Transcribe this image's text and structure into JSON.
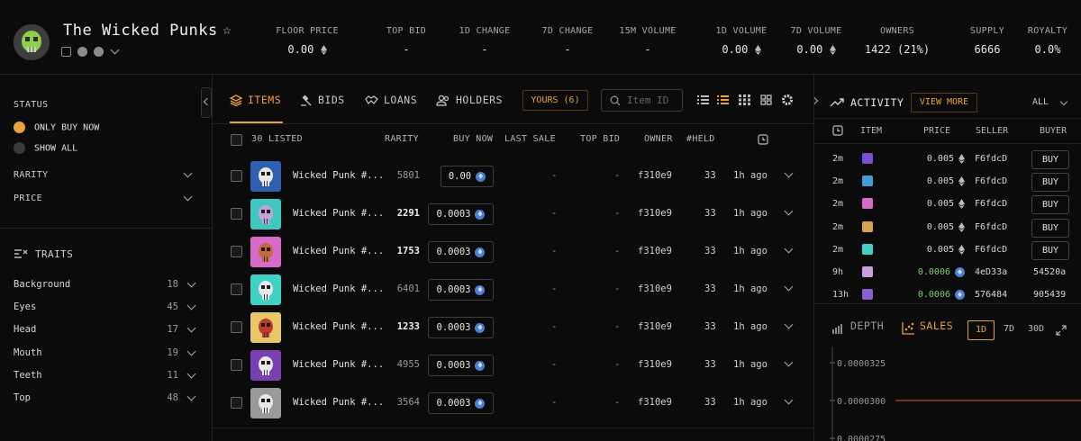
{
  "collection": {
    "title": "The Wicked Punks",
    "stats": [
      {
        "label": "FLOOR PRICE",
        "value": "0.00",
        "eth": true
      },
      {
        "label": "TOP BID",
        "value": "-",
        "eth": false
      },
      {
        "label": "1D CHANGE",
        "value": "-",
        "eth": false
      },
      {
        "label": "7D CHANGE",
        "value": "-",
        "eth": false
      },
      {
        "label": "15M VOLUME",
        "value": "-",
        "eth": false
      },
      {
        "label": "1D VOLUME",
        "value": "0.00",
        "eth": true
      },
      {
        "label": "7D VOLUME",
        "value": "0.00",
        "eth": true
      },
      {
        "label": "OWNERS",
        "value": "1422 (21%)",
        "eth": false
      },
      {
        "label": "SUPPLY",
        "value": "6666",
        "eth": false
      },
      {
        "label": "ROYALTY",
        "value": "0.0%",
        "eth": false
      }
    ]
  },
  "sidebar": {
    "status_label": "STATUS",
    "only_buy_now": "ONLY BUY NOW",
    "show_all": "SHOW ALL",
    "rarity": "RARITY",
    "price": "PRICE",
    "traits_label": "TRAITS",
    "traits": [
      {
        "name": "Background",
        "count": "18"
      },
      {
        "name": "Eyes",
        "count": "45"
      },
      {
        "name": "Head",
        "count": "17"
      },
      {
        "name": "Mouth",
        "count": "19"
      },
      {
        "name": "Teeth",
        "count": "11"
      },
      {
        "name": "Top",
        "count": "48"
      }
    ]
  },
  "main": {
    "tabs": [
      {
        "label": "ITEMS",
        "icon": "layers-icon",
        "active": true
      },
      {
        "label": "BIDS",
        "icon": "gavel-icon",
        "active": false
      },
      {
        "label": "LOANS",
        "icon": "handshake-icon",
        "active": false
      },
      {
        "label": "HOLDERS",
        "icon": "users-icon",
        "active": false
      }
    ],
    "yours": "YOURS (6)",
    "search_placeholder": "Item ID",
    "listed_count": "30 LISTED",
    "columns": [
      "RARITY",
      "BUY NOW",
      "LAST SALE",
      "TOP BID",
      "OWNER",
      "#HELD"
    ],
    "rows": [
      {
        "name": "Wicked Punk #...",
        "rarity": "5801",
        "buy": "0.00",
        "last_sale": "-",
        "top_bid": "-",
        "owner": "f310e9",
        "held": "33",
        "ago": "1h ago",
        "bg": "#2f5fb0",
        "skull": "#e8e8e8"
      },
      {
        "name": "Wicked Punk #...",
        "rarity": "2291",
        "buy": "0.0003",
        "last_sale": "-",
        "top_bid": "-",
        "owner": "f310e9",
        "held": "33",
        "ago": "1h ago",
        "bg": "#3fc6c0",
        "skull": "#c6a2d8"
      },
      {
        "name": "Wicked Punk #...",
        "rarity": "1753",
        "buy": "0.0003",
        "last_sale": "-",
        "top_bid": "-",
        "owner": "f310e9",
        "held": "33",
        "ago": "1h ago",
        "bg": "#d86ac9",
        "skull": "#c36a3a"
      },
      {
        "name": "Wicked Punk #...",
        "rarity": "6401",
        "buy": "0.0003",
        "last_sale": "-",
        "top_bid": "-",
        "owner": "f310e9",
        "held": "33",
        "ago": "1h ago",
        "bg": "#3fd0c6",
        "skull": "#e8e8e8"
      },
      {
        "name": "Wicked Punk #...",
        "rarity": "1233",
        "buy": "0.0003",
        "last_sale": "-",
        "top_bid": "-",
        "owner": "f310e9",
        "held": "33",
        "ago": "1h ago",
        "bg": "#e8c86a",
        "skull": "#c0392b"
      },
      {
        "name": "Wicked Punk #...",
        "rarity": "4955",
        "buy": "0.0003",
        "last_sale": "-",
        "top_bid": "-",
        "owner": "f310e9",
        "held": "33",
        "ago": "1h ago",
        "bg": "#7a3fb0",
        "skull": "#e8e8e8"
      },
      {
        "name": "Wicked Punk #...",
        "rarity": "3564",
        "buy": "0.0003",
        "last_sale": "-",
        "top_bid": "-",
        "owner": "f310e9",
        "held": "33",
        "ago": "1h ago",
        "bg": "#9a9a9a",
        "skull": "#e8e8e8"
      }
    ]
  },
  "activity": {
    "title": "ACTIVITY",
    "view_more": "VIEW MORE",
    "filter": "ALL",
    "columns": [
      "ITEM",
      "PRICE",
      "SELLER",
      "BUYER"
    ],
    "rows": [
      {
        "time": "2m",
        "price": "0.005",
        "seller": "F6fdcD",
        "buyer": "BUY",
        "is_button": true,
        "weth": false,
        "thumb": "#7a4fd0"
      },
      {
        "time": "2m",
        "price": "0.005",
        "seller": "F6fdcD",
        "buyer": "BUY",
        "is_button": true,
        "weth": false,
        "thumb": "#3fa0d8"
      },
      {
        "time": "2m",
        "price": "0.005",
        "seller": "F6fdcD",
        "buyer": "BUY",
        "is_button": true,
        "weth": false,
        "thumb": "#d86ac9"
      },
      {
        "time": "2m",
        "price": "0.005",
        "seller": "F6fdcD",
        "buyer": "BUY",
        "is_button": true,
        "weth": false,
        "thumb": "#d8a04f"
      },
      {
        "time": "2m",
        "price": "0.005",
        "seller": "F6fdcD",
        "buyer": "BUY",
        "is_button": true,
        "weth": false,
        "thumb": "#3fd0c6"
      },
      {
        "time": "9h",
        "price": "0.0006",
        "seller": "4eD33a",
        "buyer": "54520a",
        "is_button": false,
        "weth": true,
        "thumb": "#c6a2d8"
      },
      {
        "time": "13h",
        "price": "0.0006",
        "seller": "576484",
        "buyer": "905439",
        "is_button": false,
        "weth": true,
        "thumb": "#8a5fd0"
      }
    ],
    "chart_tabs": {
      "depth": "DEPTH",
      "sales": "SALES"
    },
    "ranges": [
      "1D",
      "7D",
      "30D"
    ],
    "active_range": "1D"
  },
  "chart_data": {
    "type": "line",
    "ytick_labels": [
      "0.0000325",
      "0.0000300",
      "0.0000275"
    ],
    "series": [
      {
        "values": [
          3e-05,
          3e-05
        ]
      }
    ],
    "line_color": "#b0463c"
  }
}
